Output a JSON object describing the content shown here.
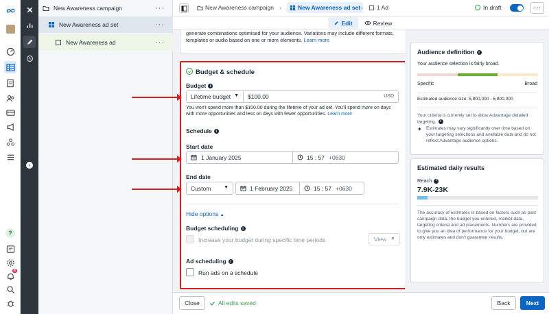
{
  "tree": {
    "campaign": "New Awareness campaign",
    "adset": "New Awareness ad set",
    "ad": "New Awareness ad",
    "more": "···"
  },
  "topbar": {
    "crumb_campaign": "New Awareness campaign",
    "crumb_adset": "New Awareness ad set",
    "crumb_ad": "1 Ad",
    "status": "In draft",
    "more": "···"
  },
  "subbar": {
    "edit": "Edit",
    "review": "Review"
  },
  "intro_text": "generate combinations optimised for your audience. Variations may include different formats, templates or audio based on one or more elements.",
  "intro_link": "Learn more",
  "budget_schedule": {
    "title": "Budget & schedule",
    "budget_label": "Budget",
    "budget_type": "Lifetime budget",
    "budget_amount": "$100.00",
    "currency": "USD",
    "budget_help": "You won't spend more than $100.00 during the lifetime of your ad set. You'll spend more on days with more opportunities and less on days with fewer opportunities.",
    "budget_help_link": "Learn more",
    "schedule_label": "Schedule",
    "start_label": "Start date",
    "start_date": "1 January 2025",
    "start_time": "15 : 57",
    "start_tz": "+0630",
    "end_label": "End date",
    "end_type": "Custom",
    "end_date": "1 February 2025",
    "end_time": "15 : 57",
    "end_tz": "+0630",
    "hide_options": "Hide options",
    "budget_scheduling_label": "Budget scheduling",
    "budget_scheduling_check": "Increase your budget during specific time periods",
    "view_label": "View",
    "ad_scheduling_label": "Ad scheduling",
    "ad_scheduling_check": "Run ads on a schedule"
  },
  "audience": {
    "title": "Audience definition",
    "subtitle": "Your audience selection is fairly broad.",
    "specific": "Specific",
    "broad": "Broad",
    "size_text": "Estimated audience size: 5,800,000 - 6,800,000",
    "criteria_text": "Your criteria is currently set to allow Advantage detailed targeting.",
    "estimates_text": "Estimates may vary significantly over time based on your targeting selections and available data and do not reflect Advantage audience options."
  },
  "daily": {
    "title": "Estimated daily results",
    "reach_label": "Reach",
    "reach_value": "7.9K-23K",
    "disclaimer": "The accuracy of estimates is based on factors such as past campaign data, the budget you entered, market data, targeting criteria and ad placements. Numbers are provided to give you an idea of performance for your budget, but are only estimates and don't guarantee results."
  },
  "footer": {
    "close": "Close",
    "saved": "All edits saved",
    "back": "Back",
    "next": "Next"
  },
  "rail": {
    "notif_count": "8"
  },
  "colors": {
    "accent": "#0a66c2",
    "highlight": "#d61f1f",
    "audience_green": "#64b32c"
  }
}
